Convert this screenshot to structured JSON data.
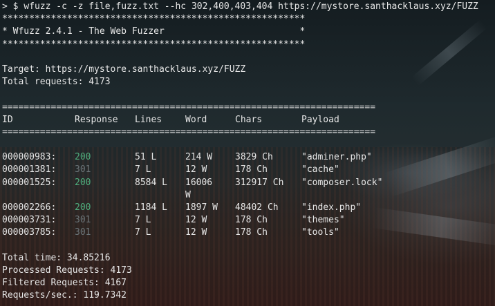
{
  "command": {
    "prompt": "> $",
    "text": "wfuzz -c -z file,fuzz.txt --hc 302,400,403,404 https://mystore.santhacklaus.xyz/FUZZ"
  },
  "banner": {
    "border": "********************************************************",
    "title_line": "* Wfuzz 2.4.1 - The Web Fuzzer                         *"
  },
  "target_line": "Target: https://mystore.santhacklaus.xyz/FUZZ",
  "total_requests_line": "Total requests: 4173",
  "separator": "=====================================================================",
  "headers": {
    "id": "ID",
    "response": "Response",
    "lines": "Lines",
    "word": "Word",
    "chars": "Chars",
    "payload": "Payload"
  },
  "results": [
    {
      "id": "000000983:",
      "response": "200",
      "lines": "51 L",
      "word": "214 W",
      "chars": "3829 Ch",
      "payload": "\"adminer.php\""
    },
    {
      "id": "000001381:",
      "response": "301",
      "lines": "7 L",
      "word": "12 W",
      "chars": "178 Ch",
      "payload": "\"cache\""
    },
    {
      "id": "000001525:",
      "response": "200",
      "lines": "8584 L",
      "word": "16006",
      "word_wrap": "W",
      "chars": "312917 Ch",
      "payload": "\"composer.lock\""
    },
    {
      "id": "000002266:",
      "response": "200",
      "lines": "1184 L",
      "word": "1897 W",
      "chars": "48402 Ch",
      "payload": "\"index.php\""
    },
    {
      "id": "000003731:",
      "response": "301",
      "lines": "7 L",
      "word": "12 W",
      "chars": "178 Ch",
      "payload": "\"themes\""
    },
    {
      "id": "000003785:",
      "response": "301",
      "lines": "7 L",
      "word": "12 W",
      "chars": "178 Ch",
      "payload": "\"tools\""
    }
  ],
  "summary": {
    "total_time": "Total time: 34.85216",
    "processed": "Processed Requests: 4173",
    "filtered": "Filtered Requests: 4167",
    "rate": "Requests/sec.: 119.7342"
  },
  "colors": {
    "status_200": "#4fae7d",
    "status_301": "#6a7478",
    "text": "#e6e6e6"
  }
}
